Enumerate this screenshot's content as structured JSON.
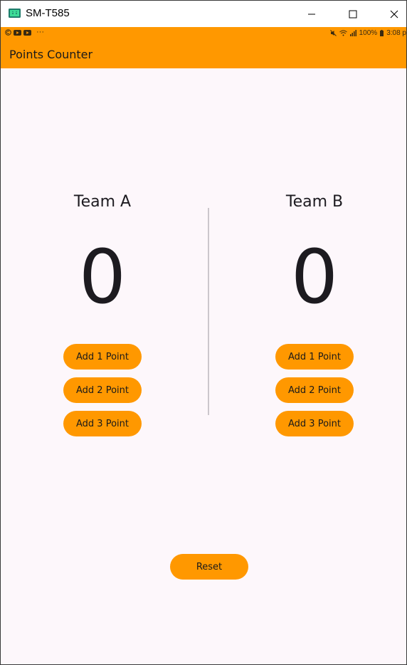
{
  "window": {
    "title": "SM-T585",
    "minimize_icon": "minimize-icon",
    "maximize_icon": "maximize-icon",
    "close_icon": "close-icon"
  },
  "status_bar": {
    "left_icons": [
      "circle-c-icon",
      "youtube-icon",
      "youtube-icon",
      "more-dots-icon"
    ],
    "dots": "···",
    "battery": "100%",
    "time": "3:08 p"
  },
  "app_bar": {
    "title": "Points Counter",
    "color": "#ff9800"
  },
  "team_a": {
    "name": "Team A",
    "score": "0",
    "buttons": [
      "Add 1 Point",
      "Add 2 Point",
      "Add 3 Point"
    ]
  },
  "team_b": {
    "name": "Team B",
    "score": "0",
    "buttons": [
      "Add 1 Point",
      "Add 2 Point",
      "Add 3 Point"
    ]
  },
  "reset_label": "Reset",
  "colors": {
    "accent": "#ff9800",
    "background": "#fdf7fb",
    "text": "#1d1b20"
  }
}
